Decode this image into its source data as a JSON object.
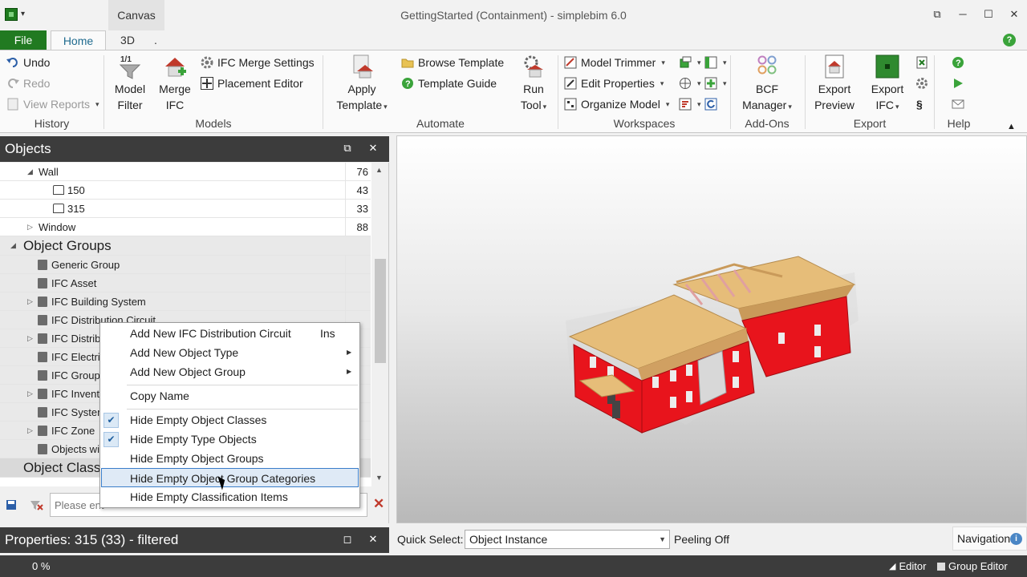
{
  "titlebar": {
    "context_tab": "Canvas",
    "title": "GettingStarted (Containment) - simplebim 6.0"
  },
  "tabs": {
    "file": "File",
    "home": "Home",
    "view3d": "3D",
    "dot": "."
  },
  "ribbon": {
    "history": {
      "undo": "Undo",
      "redo": "Redo",
      "view_reports": "View Reports",
      "label": "History"
    },
    "models": {
      "model_filter": [
        "Model",
        "Filter"
      ],
      "model_filter_badge": "1/1",
      "merge_ifc": [
        "Merge",
        "IFC"
      ],
      "ifc_merge_settings": "IFC Merge Settings",
      "placement_editor": "Placement Editor",
      "label": "Models"
    },
    "automate": {
      "apply_template": [
        "Apply",
        "Template"
      ],
      "browse_template": "Browse Template",
      "template_guide": "Template Guide",
      "run_tool": [
        "Run",
        "Tool"
      ],
      "label": "Automate"
    },
    "workspaces": {
      "model_trimmer": "Model Trimmer",
      "edit_properties": "Edit Properties",
      "organize_model": "Organize Model",
      "label": "Workspaces"
    },
    "addons": {
      "bcf_manager": [
        "BCF",
        "Manager"
      ],
      "label": "Add-Ons"
    },
    "export": {
      "export_preview": [
        "Export",
        "Preview"
      ],
      "export_ifc": [
        "Export",
        "IFC"
      ],
      "label": "Export"
    },
    "help": {
      "label": "Help",
      "section_symbol": "§"
    }
  },
  "objects_panel": {
    "title": "Objects",
    "rows": [
      {
        "label": "Wall",
        "count": "76"
      },
      {
        "label": "150",
        "count": "43"
      },
      {
        "label": "315",
        "count": "33"
      },
      {
        "label": "Window",
        "count": "88"
      },
      {
        "label": "Object Groups",
        "count": ""
      },
      {
        "label": "Generic Group",
        "count": ""
      },
      {
        "label": "IFC Asset",
        "count": ""
      },
      {
        "label": "IFC Building System",
        "count": ""
      },
      {
        "label": "IFC Distribution Circuit",
        "count": ""
      },
      {
        "label": "IFC Distrib",
        "count": ""
      },
      {
        "label": "IFC Electric",
        "count": ""
      },
      {
        "label": "IFC Group",
        "count": ""
      },
      {
        "label": "IFC Invento",
        "count": ""
      },
      {
        "label": "IFC System",
        "count": ""
      },
      {
        "label": "IFC Zone",
        "count": ""
      },
      {
        "label": "Objects wi",
        "count": ""
      },
      {
        "label": "Object Classi",
        "count": ""
      }
    ],
    "search_placeholder": "Please ent"
  },
  "context_menu": {
    "items": [
      {
        "label": "Add New IFC Distribution Circuit",
        "shortcut": "Ins"
      },
      {
        "label": "Add New Object Type"
      },
      {
        "label": "Add New Object Group"
      },
      {
        "label": "Copy Name"
      },
      {
        "label": "Hide Empty Object Classes",
        "checked": true
      },
      {
        "label": "Hide Empty Type Objects",
        "checked": true
      },
      {
        "label": "Hide Empty Object Groups",
        "checked": false
      },
      {
        "label": "Hide Empty Object Group Categories",
        "checked": false
      },
      {
        "label": "Hide Empty Classification Items",
        "checked": false
      }
    ]
  },
  "properties_panel": {
    "title": "Properties: 315 (33) - filtered"
  },
  "quick_select": {
    "label": "Quick Select:",
    "value": "Object Instance",
    "peeling": "Peeling Off",
    "navigation": "Navigation"
  },
  "statusbar": {
    "progress": "0 %",
    "editor": "Editor",
    "group_editor": "Group Editor"
  },
  "colors": {
    "accent_green": "#217a21",
    "panel_header": "#3c3c3c",
    "wall_red": "#e8141c",
    "roof_tan": "#e0b473",
    "menu_highlight": "#3a7dc9"
  }
}
